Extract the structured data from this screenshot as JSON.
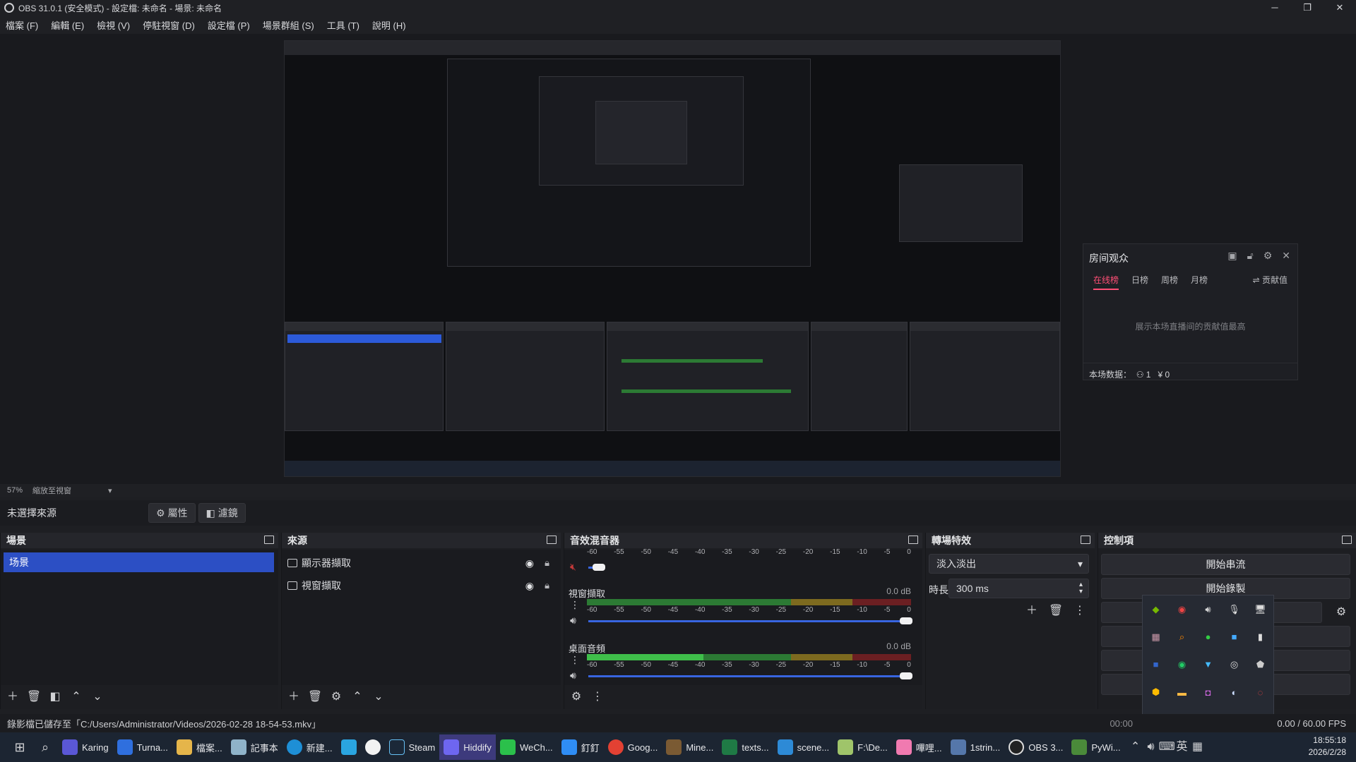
{
  "window": {
    "title": "OBS 31.0.1 (安全模式) - 設定檔: 未命名 - 場景: 未命名",
    "controls": [
      "─",
      "❐",
      "✕"
    ]
  },
  "menu": [
    "檔案 (F)",
    "編輯 (E)",
    "檢視 (V)",
    "停駐視窗 (D)",
    "設定檔 (P)",
    "場景群組 (S)",
    "工具 (T)",
    "說明 (H)"
  ],
  "preview": {
    "zoom": "57%",
    "zoom_mode": "縮放至視窗"
  },
  "context": {
    "no_source": "未選擇來源",
    "properties_label": "屬性",
    "filters_label": "濾鏡"
  },
  "docks": {
    "scenes": {
      "title": "場景",
      "items": [
        "场景"
      ]
    },
    "sources": {
      "title": "來源",
      "items": [
        "顯示器擷取",
        "視窗擷取"
      ]
    },
    "mixer": {
      "title": "音效混音器",
      "ticks": [
        "-60",
        "-55",
        "-50",
        "-45",
        "-40",
        "-35",
        "-30",
        "-25",
        "-20",
        "-15",
        "-10",
        "-5",
        "0"
      ],
      "tracks": [
        {
          "name": "",
          "db": ""
        },
        {
          "name": "視窗擷取",
          "db": "0.0 dB"
        },
        {
          "name": "桌面音頻",
          "db": "0.0 dB"
        }
      ]
    },
    "transitions": {
      "title": "轉場特效",
      "type": "淡入淡出",
      "duration_label": "時長",
      "duration": "300 ms"
    },
    "controls": {
      "title": "控制項",
      "buttons": [
        "開始串流",
        "開始錄製"
      ]
    }
  },
  "status": {
    "saved": "錄影檔已儲存至「C:/Users/Administrator/Videos/2026-02-28 18-54-53.mkv」",
    "rec_time": "00:00",
    "fps": "0.00 / 60.00 FPS"
  },
  "popup": {
    "title": "房间观众",
    "tabs": [
      "在线榜",
      "日榜",
      "周榜",
      "月榜"
    ],
    "right_tab": "贡献值",
    "message": "展示本场直播间的贡献值最高",
    "stats_label": "本场数据：",
    "stat_users": "1",
    "stat_coins": "0"
  },
  "taskbar": {
    "items": [
      "Karing",
      "Turna...",
      "檔案...",
      "記事本",
      "新建...",
      "",
      "",
      "Steam",
      "Hiddify",
      "WeCh...",
      "釘釘",
      "Goog...",
      "Mine...",
      "texts...",
      "scene...",
      "F:\\De...",
      "嗶哩...",
      "1strin...",
      "OBS 3...",
      "PyWi..."
    ],
    "ime": "英",
    "time": "18:55:18",
    "date": "2026/2/28"
  }
}
